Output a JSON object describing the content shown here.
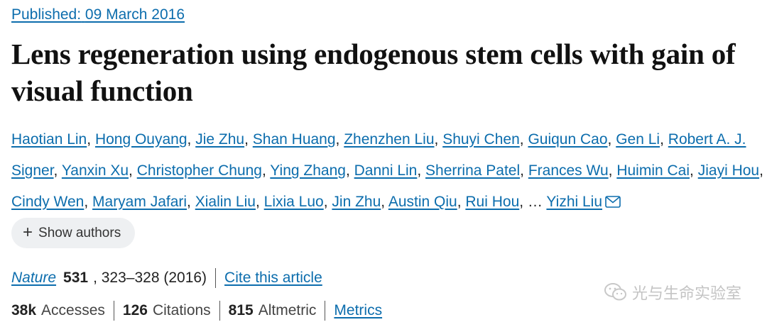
{
  "published": {
    "label": "Published:",
    "date": "09 March 2016"
  },
  "title": "Lens regeneration using endogenous stem cells with gain of visual function",
  "authors": {
    "list": [
      "Haotian Lin",
      "Hong Ouyang",
      "Jie Zhu",
      "Shan Huang",
      "Zhenzhen Liu",
      "Shuyi Chen",
      "Guiqun Cao",
      "Gen Li",
      "Robert A. J. Signer",
      "Yanxin Xu",
      "Christopher Chung",
      "Ying Zhang",
      "Danni Lin",
      "Sherrina Patel",
      "Frances Wu",
      "Huimin Cai",
      "Jiayi Hou",
      "Cindy Wen",
      "Maryam Jafari",
      "Xialin Liu",
      "Lixia Luo",
      "Jin Zhu",
      "Austin Qiu",
      "Rui Hou"
    ],
    "separator": ",",
    "ellipsis": "…",
    "corresponding": "Yizhi Liu",
    "corresponding_icon": "mail-icon"
  },
  "show_authors": {
    "icon": "plus-icon",
    "label": "Show authors"
  },
  "citation": {
    "journal": "Nature",
    "volume": "531",
    "pages": ", 323–328 (2016)",
    "cite_link": "Cite this article"
  },
  "metrics": {
    "accesses_value": "38k",
    "accesses_label": "Accesses",
    "citations_value": "126",
    "citations_label": "Citations",
    "altmetric_value": "815",
    "altmetric_label": "Altmetric",
    "metrics_link": "Metrics"
  },
  "watermark": {
    "icon": "wechat-icon",
    "text": "光与生命实验室"
  },
  "colors": {
    "link": "#0c6dad",
    "text": "#222222",
    "pill_bg": "#eef0f2"
  }
}
